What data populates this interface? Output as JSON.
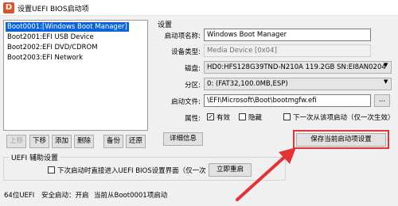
{
  "window": {
    "title": "设置UEFI BIOS启动项",
    "app_icon_letter": "D"
  },
  "boot_list": [
    "Boot0001:[Windows Boot Manager]",
    "Boot2001:EFI USB Device",
    "Boot2002:EFI DVD/CDROM",
    "Boot2003:EFI Network"
  ],
  "list_buttons": {
    "up": "上移",
    "down": "下移",
    "add": "添加",
    "delete": "删除",
    "backup": "备份",
    "restore": "还原"
  },
  "settings": {
    "group_title": "设置",
    "name_label": "启动项名称:",
    "name_value": "Windows Boot Manager",
    "device_type_label": "设备类型:",
    "device_type_value": "Media Device [0x04]",
    "disk_label": "磁盘:",
    "disk_value": "HD0:HFS128G39TND-N210A 119.2GB SN:EI8AN0204",
    "partition_label": "分区:",
    "partition_value": "0: (FAT32,100.0MB,ESP)",
    "file_label": "启动文件:",
    "file_value": "\\EFI\\Microsoft\\Boot\\bootmgfw.efi",
    "browse_label": "...",
    "attr_label": "属性:",
    "attr_active": "有效",
    "attr_hidden": "隐藏",
    "attr_next_once": "下一次从该项启动（仅一次生效）",
    "details_button": "详细信息",
    "save_button": "保存当前启动项设置"
  },
  "uefi_assist": {
    "group_title": "UEFI 辅助设置",
    "checkbox_label": "下次启动时直接进入UEFI BIOS设置界面（仅一次",
    "reboot_button": "立即重启"
  },
  "status": {
    "mode": "64位UEFI",
    "secure_boot": "安全启动：开启",
    "current_boot": "当前从Boot0001项启动"
  },
  "colors": {
    "selection": "#0a64d8",
    "highlight_border": "#e63232",
    "arrow": "#e63232"
  }
}
